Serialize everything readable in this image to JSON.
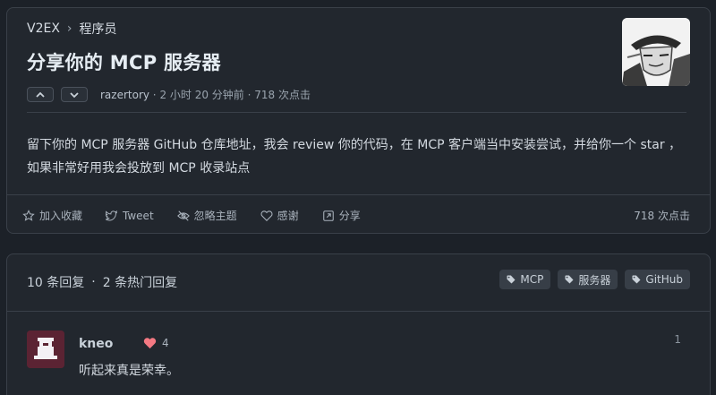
{
  "breadcrumb": {
    "site": "V2EX",
    "separator": "›",
    "node": "程序员"
  },
  "topic": {
    "title": "分享你的 MCP 服务器",
    "author": "razertory",
    "time": "2 小时 20 分钟前",
    "clicks": "718 次点击",
    "content": "留下你的 MCP 服务器 GitHub 仓库地址，我会 review 你的代码，在 MCP 客户端当中安装尝试，并给你一个 star ，如果非常好用我会投放到 MCP 收录站点"
  },
  "actions": {
    "favorite": "加入收藏",
    "tweet": "Tweet",
    "ignore": "忽略主题",
    "thanks": "感谢",
    "share": "分享",
    "clicks": "718 次点击"
  },
  "replies": {
    "count": "10 条回复",
    "dot": "·",
    "hot": "2 条热门回复",
    "tags": [
      "MCP",
      "服务器",
      "GitHub"
    ],
    "items": [
      {
        "user": "kneo",
        "likes": "4",
        "floor": "1",
        "text": "听起来真是荣幸。"
      }
    ]
  },
  "colors": {
    "background": "#1c2128",
    "card": "#22272e",
    "border": "#3a4049",
    "heart": "#f47983"
  }
}
